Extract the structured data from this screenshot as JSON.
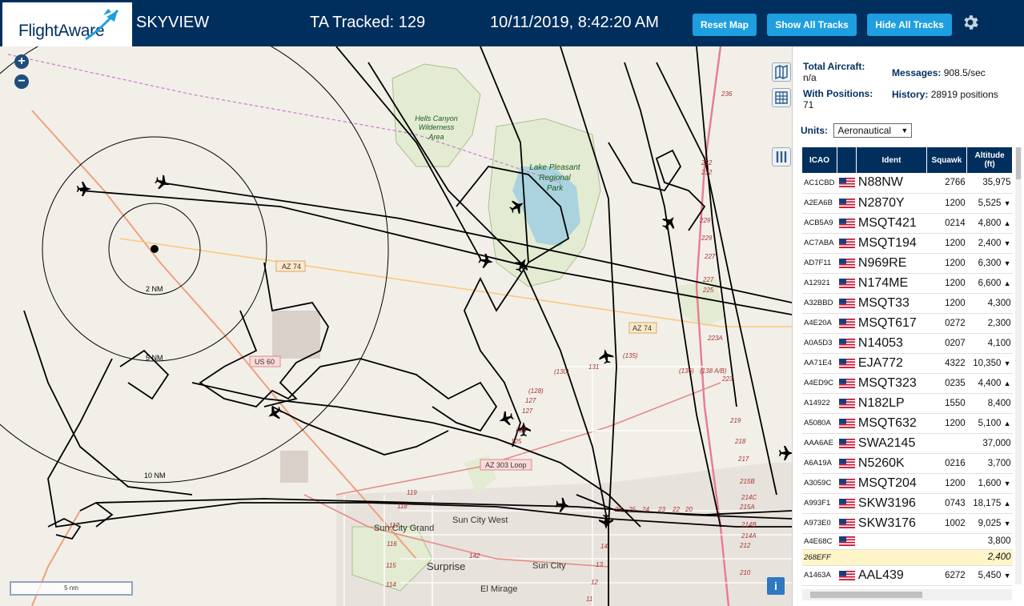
{
  "header": {
    "logo": "FlightAware",
    "title": "SKYVIEW",
    "tracked": "TA Tracked: 129",
    "datetime": "10/11/2019, 8:42:20 AM",
    "buttons": {
      "reset": "Reset Map",
      "show_all": "Show All Tracks",
      "hide_all": "Hide All Tracks"
    }
  },
  "map": {
    "zoom_in": "+",
    "zoom_out": "−",
    "range_rings": [
      "2 NM",
      "5 NM",
      "10 NM"
    ],
    "scale": "5 nm",
    "labels": {
      "hells_canyon": [
        "Hells Canyon",
        "Wilderness",
        "Area"
      ],
      "lake_pleasant": [
        "Lake Pleasant",
        "Regional",
        "Park"
      ],
      "az74_a": "AZ 74",
      "az74_b": "AZ 74",
      "us60": "US 60",
      "az303": "AZ 303 Loop",
      "sun_city_grand": "Sun City Grand",
      "sun_city_west": "Sun City West",
      "sun_city": "Sun City",
      "surprise": "Surprise",
      "el_mirage": "El Mirage"
    },
    "route_numbers": [
      "236",
      "232",
      "232",
      "229",
      "229",
      "227",
      "227",
      "225",
      "223A",
      "223",
      "219",
      "218",
      "217",
      "215B",
      "215A",
      "214C",
      "214B",
      "214A",
      "212",
      "210",
      "(130)",
      "131",
      "(135)",
      "(136)",
      "(138 A/B)",
      "(128)",
      "127",
      "127",
      "125",
      "125",
      "119",
      "118",
      "117",
      "116",
      "115",
      "114",
      "142",
      "14",
      "13",
      "12",
      "11",
      "20",
      "22",
      "23",
      "24",
      "25",
      "26"
    ],
    "info": "i"
  },
  "sidebar": {
    "stats": {
      "total_label": "Total Aircraft:",
      "total_value": "n/a",
      "positions_label": "With Positions:",
      "positions_value": "71",
      "messages_label": "Messages:",
      "messages_value": "908.5/sec",
      "history_label": "History:",
      "history_value": "28919 positions"
    },
    "units_label": "Units:",
    "units_value": "Aeronautical",
    "columns": [
      "ICAO",
      "",
      "Ident",
      "Squawk",
      "Altitude (ft)"
    ],
    "rows": [
      {
        "icao": "AC1CBD",
        "ident": "N88NW",
        "squawk": "2766",
        "alt": "35,975",
        "trend": ""
      },
      {
        "icao": "A2EA6B",
        "ident": "N2870Y",
        "squawk": "1200",
        "alt": "5,525",
        "trend": "▼"
      },
      {
        "icao": "ACB5A9",
        "ident": "MSQT421",
        "squawk": "0214",
        "alt": "4,800",
        "trend": "▲"
      },
      {
        "icao": "AC7ABA",
        "ident": "MSQT194",
        "squawk": "1200",
        "alt": "2,400",
        "trend": "▼"
      },
      {
        "icao": "AD7F11",
        "ident": "N969RE",
        "squawk": "1200",
        "alt": "6,300",
        "trend": "▼"
      },
      {
        "icao": "A12921",
        "ident": "N174ME",
        "squawk": "1200",
        "alt": "6,600",
        "trend": "▲"
      },
      {
        "icao": "A32BBD",
        "ident": "MSQT33",
        "squawk": "1200",
        "alt": "4,300",
        "trend": ""
      },
      {
        "icao": "A4E20A",
        "ident": "MSQT617",
        "squawk": "0272",
        "alt": "2,300",
        "trend": ""
      },
      {
        "icao": "A0A5D3",
        "ident": "N14053",
        "squawk": "0207",
        "alt": "4,100",
        "trend": ""
      },
      {
        "icao": "AA71E4",
        "ident": "EJA772",
        "squawk": "4322",
        "alt": "10,350",
        "trend": "▼"
      },
      {
        "icao": "A4ED9C",
        "ident": "MSQT323",
        "squawk": "0235",
        "alt": "4,400",
        "trend": "▲"
      },
      {
        "icao": "A14922",
        "ident": "N182LP",
        "squawk": "1550",
        "alt": "8,400",
        "trend": ""
      },
      {
        "icao": "A5080A",
        "ident": "MSQT632",
        "squawk": "1200",
        "alt": "5,100",
        "trend": "▲"
      },
      {
        "icao": "AAA6AE",
        "ident": "SWA2145",
        "squawk": "",
        "alt": "37,000",
        "trend": ""
      },
      {
        "icao": "A6A19A",
        "ident": "N5260K",
        "squawk": "0216",
        "alt": "3,700",
        "trend": ""
      },
      {
        "icao": "A3059C",
        "ident": "MSQT204",
        "squawk": "1200",
        "alt": "1,600",
        "trend": "▼"
      },
      {
        "icao": "A993F1",
        "ident": "SKW3196",
        "squawk": "0743",
        "alt": "18,175",
        "trend": "▲"
      },
      {
        "icao": "A973E0",
        "ident": "SKW3176",
        "squawk": "1002",
        "alt": "9,025",
        "trend": "▼"
      },
      {
        "icao": "A4E68C",
        "ident": "",
        "squawk": "",
        "alt": "3,800",
        "trend": ""
      },
      {
        "icao": "268EFF",
        "ident": "",
        "squawk": "",
        "alt": "2,400",
        "trend": ""
      },
      {
        "icao": "A1463A",
        "ident": "AAL439",
        "squawk": "6272",
        "alt": "5,450",
        "trend": "▼"
      }
    ]
  }
}
